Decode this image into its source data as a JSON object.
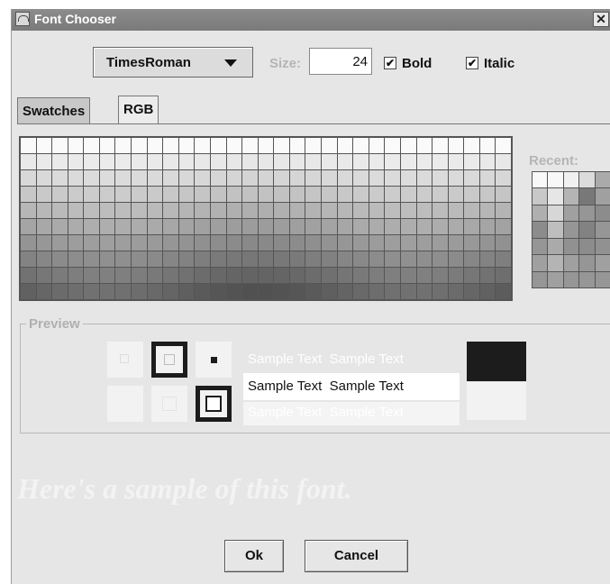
{
  "window": {
    "title": "Font Chooser",
    "close_glyph": "✕",
    "icon": "java-cup-icon"
  },
  "font_bar": {
    "font_family": "TimesRoman",
    "size_label": "Size:",
    "size_value": "24",
    "bold": {
      "label": "Bold",
      "checked": true,
      "mark": "✔"
    },
    "italic": {
      "label": "Italic",
      "checked": true,
      "mark": "✔"
    }
  },
  "tabs": [
    {
      "label": "Swatches",
      "selected": false
    },
    {
      "label": "RGB",
      "selected": true
    }
  ],
  "swatches": {
    "recent_label": "Recent:"
  },
  "preview": {
    "legend": "Preview",
    "sample_rows": [
      [
        "Sample Text",
        "Sample Text"
      ],
      [
        "Sample Text",
        "Sample Text"
      ],
      [
        "Sample Text",
        "Sample Text"
      ]
    ],
    "colors": {
      "dark": "#1c1c1c",
      "light": "#f2f2f2",
      "frame": "#dddddd"
    }
  },
  "font_sample": "Here's a sample of this font.",
  "buttons": {
    "ok": "Ok",
    "cancel": "Cancel"
  }
}
